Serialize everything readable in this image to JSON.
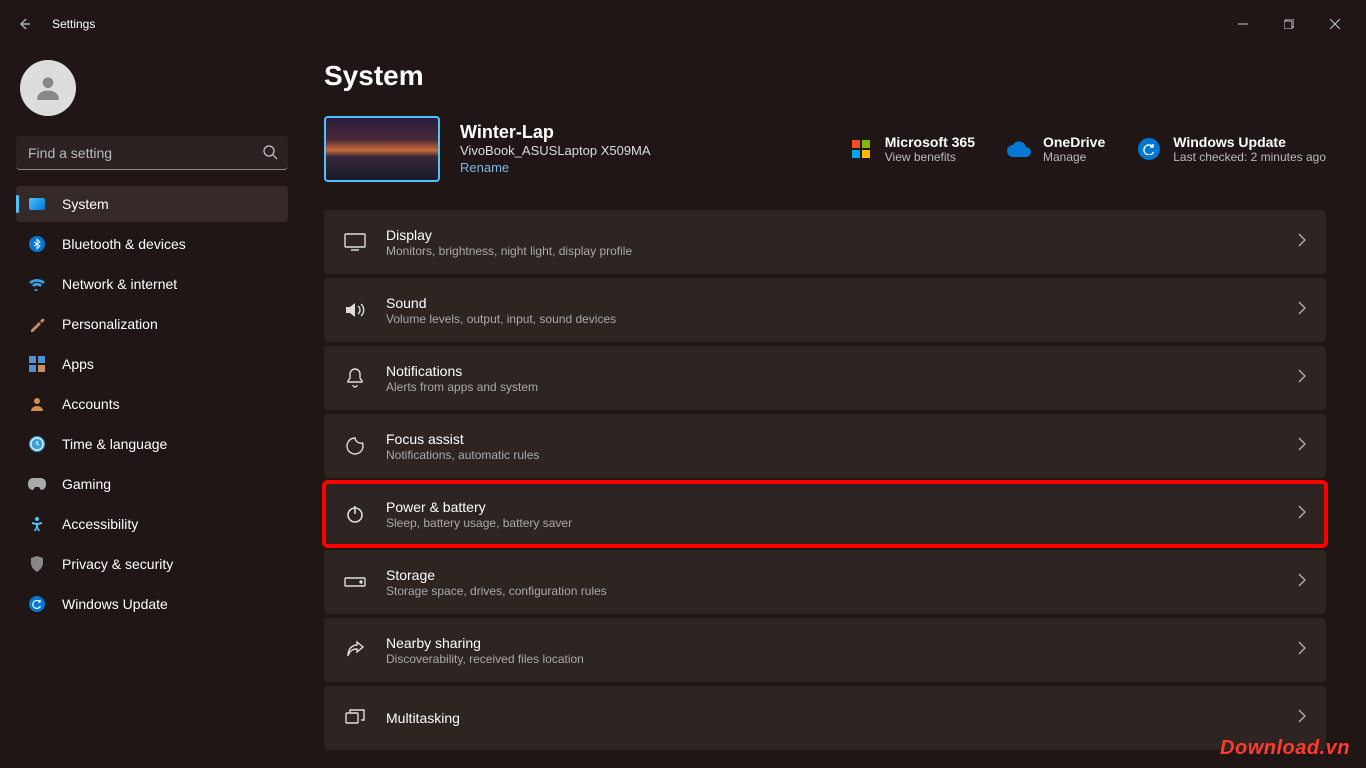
{
  "titlebar": {
    "title": "Settings"
  },
  "profile": {
    "name": "",
    "email": ""
  },
  "search": {
    "placeholder": "Find a setting"
  },
  "nav": [
    {
      "label": "System",
      "icon": "system"
    },
    {
      "label": "Bluetooth & devices",
      "icon": "bluetooth"
    },
    {
      "label": "Network & internet",
      "icon": "network"
    },
    {
      "label": "Personalization",
      "icon": "personalization"
    },
    {
      "label": "Apps",
      "icon": "apps"
    },
    {
      "label": "Accounts",
      "icon": "accounts"
    },
    {
      "label": "Time & language",
      "icon": "time"
    },
    {
      "label": "Gaming",
      "icon": "gaming"
    },
    {
      "label": "Accessibility",
      "icon": "accessibility"
    },
    {
      "label": "Privacy & security",
      "icon": "privacy"
    },
    {
      "label": "Windows Update",
      "icon": "update"
    }
  ],
  "page": {
    "title": "System"
  },
  "device": {
    "name": "Winter-Lap",
    "model": "VivoBook_ASUSLaptop X509MA",
    "rename": "Rename"
  },
  "header_links": [
    {
      "title": "Microsoft 365",
      "subtitle": "View benefits",
      "icon": "ms365"
    },
    {
      "title": "OneDrive",
      "subtitle": "Manage",
      "icon": "onedrive"
    },
    {
      "title": "Windows Update",
      "subtitle": "Last checked: 2 minutes ago",
      "icon": "winupdate"
    }
  ],
  "cards": [
    {
      "title": "Display",
      "subtitle": "Monitors, brightness, night light, display profile",
      "icon": "display"
    },
    {
      "title": "Sound",
      "subtitle": "Volume levels, output, input, sound devices",
      "icon": "sound"
    },
    {
      "title": "Notifications",
      "subtitle": "Alerts from apps and system",
      "icon": "notifications"
    },
    {
      "title": "Focus assist",
      "subtitle": "Notifications, automatic rules",
      "icon": "focus"
    },
    {
      "title": "Power & battery",
      "subtitle": "Sleep, battery usage, battery saver",
      "icon": "power",
      "highlight": true
    },
    {
      "title": "Storage",
      "subtitle": "Storage space, drives, configuration rules",
      "icon": "storage"
    },
    {
      "title": "Nearby sharing",
      "subtitle": "Discoverability, received files location",
      "icon": "share"
    },
    {
      "title": "Multitasking",
      "subtitle": "",
      "icon": "multitask"
    }
  ],
  "watermark": "Download.vn"
}
